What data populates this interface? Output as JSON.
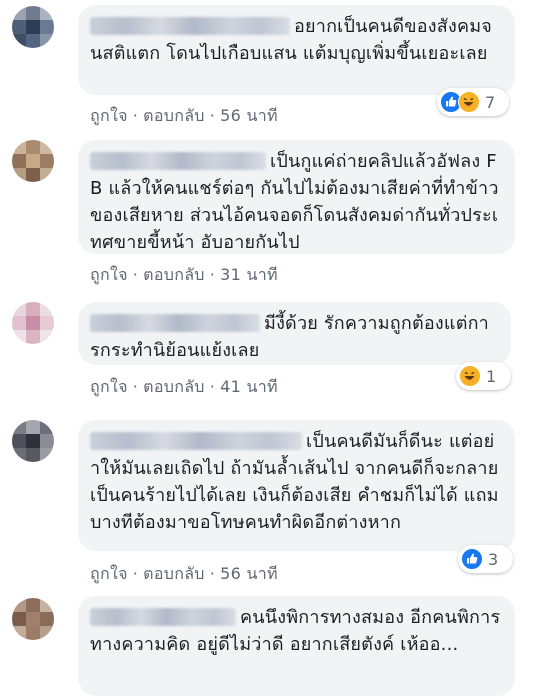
{
  "colors": {
    "bubble_bg": "#f2f3f5",
    "action_text": "#606770",
    "like_blue": "#1877f2",
    "haha_yellow": "#f7b125"
  },
  "comments": [
    {
      "text": "อยากเป็นคนดีของสังคมจนสติแตก โดนไปเกือบแสน แต้มบุญเพิ่มขึ้นเยอะเลย",
      "like_label": "ถูกใจ",
      "reply_label": "ตอบกลับ",
      "time": "56 นาที",
      "reactions": [
        "like-icon",
        "haha-icon"
      ],
      "reaction_count": "7"
    },
    {
      "text": "เป็นกูแค่ถ่ายคลิปแล้วอัฟลง FB แล้วให้คนแชร์ต่อๆ กันไปไม่ต้องมาเสียค่าที่ทำข้าวของเสียหาย ส่วนไอ้คนจอดก็โดนสังคมด่ากันทั่วประเทศขายขี้หน้า อับอายกันไป",
      "like_label": "ถูกใจ",
      "reply_label": "ตอบกลับ",
      "time": "31 นาที"
    },
    {
      "text": "มีงี้ด้วย รักความถูกต้องแต่การกระทำนิย้อนแย้งเลย",
      "like_label": "ถูกใจ",
      "reply_label": "ตอบกลับ",
      "time": "41 นาที",
      "reactions": [
        "haha-icon"
      ],
      "reaction_count": "1"
    },
    {
      "text": "เป็นคนดีมันก็ดีนะ แต่อย่าให้มันเลยเถิดไป ถ้ามันล้ำเส้นไป จากคนดีก็จะกลายเป็นคนร้ายไปได้เลย เงินก็ต้องเสีย คำชมก็ไม่ได้ แถมบางทีต้องมาขอโทษคนทำผิดอีกต่างหาก",
      "like_label": "ถูกใจ",
      "reply_label": "ตอบกลับ",
      "time": "56 นาที",
      "reactions": [
        "like-icon"
      ],
      "reaction_count": "3"
    },
    {
      "text": "คนนึงพิการทางสมอง อีกคนพิการทางความคิด อยู่ดีไม่ว่าดี อยากเสียตังค์ เห้ออ...",
      "like_label": "",
      "reply_label": "",
      "time": ""
    }
  ]
}
